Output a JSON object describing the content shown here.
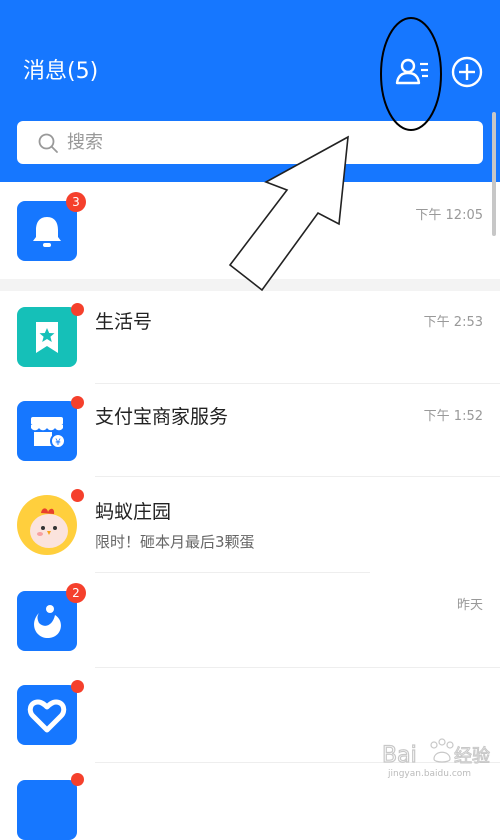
{
  "header": {
    "title": "消息(5)",
    "search_placeholder": "搜索"
  },
  "messages": [
    {
      "name": "",
      "subtitle": "",
      "time": "下午 12:05",
      "badge": "3",
      "icon": "bell-icon",
      "color": "#1677ff"
    },
    {
      "name": "生活号",
      "subtitle": "",
      "time": "下午 2:53",
      "badge": "",
      "icon": "bookmark-star-icon",
      "color": "#15c0b8"
    },
    {
      "name": "支付宝商家服务",
      "subtitle": "",
      "time": "下午 1:52",
      "badge": "",
      "icon": "store-icon",
      "color": "#1677ff"
    },
    {
      "name": "蚂蚁庄园",
      "subtitle": "限时！砸本月最后3颗蛋",
      "time": "",
      "badge": "",
      "icon": "chicken-icon",
      "color": "#ffcf3d"
    },
    {
      "name": "",
      "subtitle": "",
      "time": "昨天",
      "badge": "2",
      "icon": "swirl-icon",
      "color": "#1677ff"
    },
    {
      "name": "",
      "subtitle": "",
      "time": "",
      "badge": "",
      "icon": "heart-icon",
      "color": "#1677ff"
    },
    {
      "name": "",
      "subtitle": "",
      "time": "",
      "badge": "",
      "icon": "app-icon",
      "color": "#1677ff"
    }
  ],
  "watermark": {
    "brand": "Bai",
    "brand_cn": "经验",
    "url": "jingyan.baidu.com"
  },
  "colors": {
    "header": "#1677ff",
    "badge": "#f5402c"
  }
}
